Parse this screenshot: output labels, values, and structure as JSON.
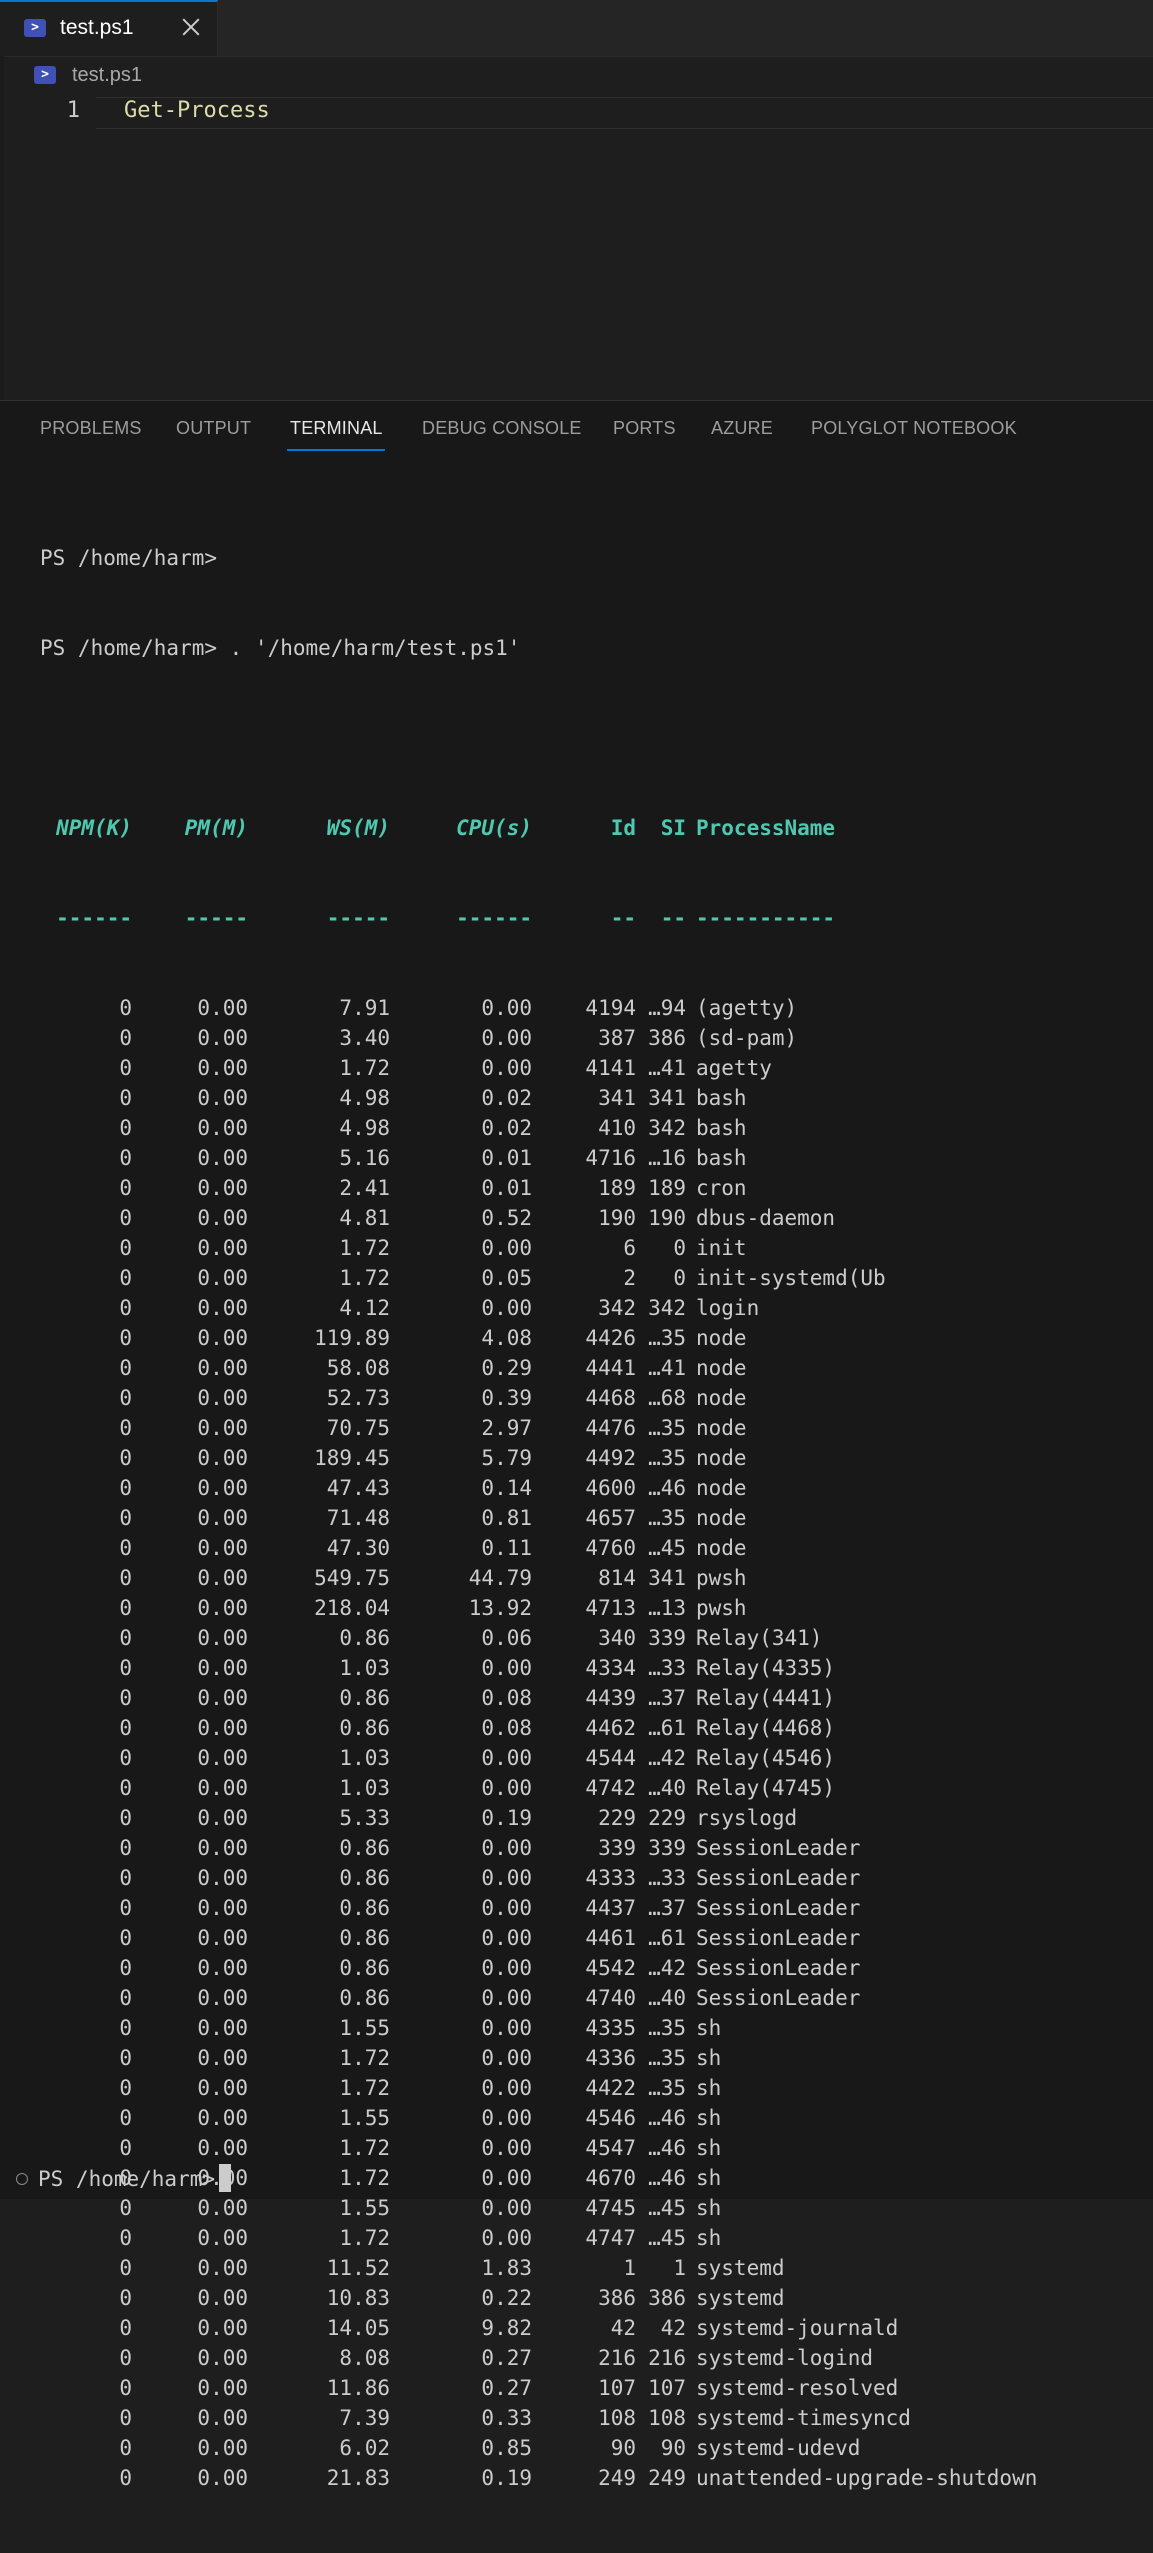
{
  "tab": {
    "title": "test.ps1",
    "icon": "powershell-icon"
  },
  "breadcrumb": {
    "file": "test.ps1",
    "icon": "powershell-icon"
  },
  "editor": {
    "line_number": "1",
    "code": "Get-Process"
  },
  "panel": {
    "tabs": [
      {
        "label": "PROBLEMS",
        "active": false
      },
      {
        "label": "OUTPUT",
        "active": false
      },
      {
        "label": "TERMINAL",
        "active": true
      },
      {
        "label": "DEBUG CONSOLE",
        "active": false
      },
      {
        "label": "PORTS",
        "active": false
      },
      {
        "label": "AZURE",
        "active": false
      },
      {
        "label": "POLYGLOT NOTEBOOK",
        "active": false
      }
    ]
  },
  "terminal": {
    "prompt1": "PS /home/harm>",
    "prompt2": "PS /home/harm> . '/home/harm/test.ps1'",
    "final_prompt": "PS /home/harm>",
    "headers": {
      "npm": "NPM(K)",
      "pm": "PM(M)",
      "ws": "WS(M)",
      "cpu": "CPU(s)",
      "id": "Id",
      "si": "SI",
      "name": "ProcessName"
    },
    "separators": {
      "npm": "------",
      "pm": "-----",
      "ws": "-----",
      "cpu": "------",
      "id": "--",
      "si": "--",
      "name": "-----------"
    },
    "rows": [
      {
        "npm": "0",
        "pm": "0.00",
        "ws": "7.91",
        "cpu": "0.00",
        "id": "4194",
        "si": "…94",
        "name": "(agetty)"
      },
      {
        "npm": "0",
        "pm": "0.00",
        "ws": "3.40",
        "cpu": "0.00",
        "id": "387",
        "si": "386",
        "name": "(sd-pam)"
      },
      {
        "npm": "0",
        "pm": "0.00",
        "ws": "1.72",
        "cpu": "0.00",
        "id": "4141",
        "si": "…41",
        "name": "agetty"
      },
      {
        "npm": "0",
        "pm": "0.00",
        "ws": "4.98",
        "cpu": "0.02",
        "id": "341",
        "si": "341",
        "name": "bash"
      },
      {
        "npm": "0",
        "pm": "0.00",
        "ws": "4.98",
        "cpu": "0.02",
        "id": "410",
        "si": "342",
        "name": "bash"
      },
      {
        "npm": "0",
        "pm": "0.00",
        "ws": "5.16",
        "cpu": "0.01",
        "id": "4716",
        "si": "…16",
        "name": "bash"
      },
      {
        "npm": "0",
        "pm": "0.00",
        "ws": "2.41",
        "cpu": "0.01",
        "id": "189",
        "si": "189",
        "name": "cron"
      },
      {
        "npm": "0",
        "pm": "0.00",
        "ws": "4.81",
        "cpu": "0.52",
        "id": "190",
        "si": "190",
        "name": "dbus-daemon"
      },
      {
        "npm": "0",
        "pm": "0.00",
        "ws": "1.72",
        "cpu": "0.00",
        "id": "6",
        "si": "0",
        "name": "init"
      },
      {
        "npm": "0",
        "pm": "0.00",
        "ws": "1.72",
        "cpu": "0.05",
        "id": "2",
        "si": "0",
        "name": "init-systemd(Ub"
      },
      {
        "npm": "0",
        "pm": "0.00",
        "ws": "4.12",
        "cpu": "0.00",
        "id": "342",
        "si": "342",
        "name": "login"
      },
      {
        "npm": "0",
        "pm": "0.00",
        "ws": "119.89",
        "cpu": "4.08",
        "id": "4426",
        "si": "…35",
        "name": "node"
      },
      {
        "npm": "0",
        "pm": "0.00",
        "ws": "58.08",
        "cpu": "0.29",
        "id": "4441",
        "si": "…41",
        "name": "node"
      },
      {
        "npm": "0",
        "pm": "0.00",
        "ws": "52.73",
        "cpu": "0.39",
        "id": "4468",
        "si": "…68",
        "name": "node"
      },
      {
        "npm": "0",
        "pm": "0.00",
        "ws": "70.75",
        "cpu": "2.97",
        "id": "4476",
        "si": "…35",
        "name": "node"
      },
      {
        "npm": "0",
        "pm": "0.00",
        "ws": "189.45",
        "cpu": "5.79",
        "id": "4492",
        "si": "…35",
        "name": "node"
      },
      {
        "npm": "0",
        "pm": "0.00",
        "ws": "47.43",
        "cpu": "0.14",
        "id": "4600",
        "si": "…46",
        "name": "node"
      },
      {
        "npm": "0",
        "pm": "0.00",
        "ws": "71.48",
        "cpu": "0.81",
        "id": "4657",
        "si": "…35",
        "name": "node"
      },
      {
        "npm": "0",
        "pm": "0.00",
        "ws": "47.30",
        "cpu": "0.11",
        "id": "4760",
        "si": "…45",
        "name": "node"
      },
      {
        "npm": "0",
        "pm": "0.00",
        "ws": "549.75",
        "cpu": "44.79",
        "id": "814",
        "si": "341",
        "name": "pwsh"
      },
      {
        "npm": "0",
        "pm": "0.00",
        "ws": "218.04",
        "cpu": "13.92",
        "id": "4713",
        "si": "…13",
        "name": "pwsh"
      },
      {
        "npm": "0",
        "pm": "0.00",
        "ws": "0.86",
        "cpu": "0.06",
        "id": "340",
        "si": "339",
        "name": "Relay(341)"
      },
      {
        "npm": "0",
        "pm": "0.00",
        "ws": "1.03",
        "cpu": "0.00",
        "id": "4334",
        "si": "…33",
        "name": "Relay(4335)"
      },
      {
        "npm": "0",
        "pm": "0.00",
        "ws": "0.86",
        "cpu": "0.08",
        "id": "4439",
        "si": "…37",
        "name": "Relay(4441)"
      },
      {
        "npm": "0",
        "pm": "0.00",
        "ws": "0.86",
        "cpu": "0.08",
        "id": "4462",
        "si": "…61",
        "name": "Relay(4468)"
      },
      {
        "npm": "0",
        "pm": "0.00",
        "ws": "1.03",
        "cpu": "0.00",
        "id": "4544",
        "si": "…42",
        "name": "Relay(4546)"
      },
      {
        "npm": "0",
        "pm": "0.00",
        "ws": "1.03",
        "cpu": "0.00",
        "id": "4742",
        "si": "…40",
        "name": "Relay(4745)"
      },
      {
        "npm": "0",
        "pm": "0.00",
        "ws": "5.33",
        "cpu": "0.19",
        "id": "229",
        "si": "229",
        "name": "rsyslogd"
      },
      {
        "npm": "0",
        "pm": "0.00",
        "ws": "0.86",
        "cpu": "0.00",
        "id": "339",
        "si": "339",
        "name": "SessionLeader"
      },
      {
        "npm": "0",
        "pm": "0.00",
        "ws": "0.86",
        "cpu": "0.00",
        "id": "4333",
        "si": "…33",
        "name": "SessionLeader"
      },
      {
        "npm": "0",
        "pm": "0.00",
        "ws": "0.86",
        "cpu": "0.00",
        "id": "4437",
        "si": "…37",
        "name": "SessionLeader"
      },
      {
        "npm": "0",
        "pm": "0.00",
        "ws": "0.86",
        "cpu": "0.00",
        "id": "4461",
        "si": "…61",
        "name": "SessionLeader"
      },
      {
        "npm": "0",
        "pm": "0.00",
        "ws": "0.86",
        "cpu": "0.00",
        "id": "4542",
        "si": "…42",
        "name": "SessionLeader"
      },
      {
        "npm": "0",
        "pm": "0.00",
        "ws": "0.86",
        "cpu": "0.00",
        "id": "4740",
        "si": "…40",
        "name": "SessionLeader"
      },
      {
        "npm": "0",
        "pm": "0.00",
        "ws": "1.55",
        "cpu": "0.00",
        "id": "4335",
        "si": "…35",
        "name": "sh"
      },
      {
        "npm": "0",
        "pm": "0.00",
        "ws": "1.72",
        "cpu": "0.00",
        "id": "4336",
        "si": "…35",
        "name": "sh"
      },
      {
        "npm": "0",
        "pm": "0.00",
        "ws": "1.72",
        "cpu": "0.00",
        "id": "4422",
        "si": "…35",
        "name": "sh"
      },
      {
        "npm": "0",
        "pm": "0.00",
        "ws": "1.55",
        "cpu": "0.00",
        "id": "4546",
        "si": "…46",
        "name": "sh"
      },
      {
        "npm": "0",
        "pm": "0.00",
        "ws": "1.72",
        "cpu": "0.00",
        "id": "4547",
        "si": "…46",
        "name": "sh"
      },
      {
        "npm": "0",
        "pm": "0.00",
        "ws": "1.72",
        "cpu": "0.00",
        "id": "4670",
        "si": "…46",
        "name": "sh"
      },
      {
        "npm": "0",
        "pm": "0.00",
        "ws": "1.55",
        "cpu": "0.00",
        "id": "4745",
        "si": "…45",
        "name": "sh"
      },
      {
        "npm": "0",
        "pm": "0.00",
        "ws": "1.72",
        "cpu": "0.00",
        "id": "4747",
        "si": "…45",
        "name": "sh"
      },
      {
        "npm": "0",
        "pm": "0.00",
        "ws": "11.52",
        "cpu": "1.83",
        "id": "1",
        "si": "1",
        "name": "systemd"
      },
      {
        "npm": "0",
        "pm": "0.00",
        "ws": "10.83",
        "cpu": "0.22",
        "id": "386",
        "si": "386",
        "name": "systemd"
      },
      {
        "npm": "0",
        "pm": "0.00",
        "ws": "14.05",
        "cpu": "9.82",
        "id": "42",
        "si": "42",
        "name": "systemd-journald"
      },
      {
        "npm": "0",
        "pm": "0.00",
        "ws": "8.08",
        "cpu": "0.27",
        "id": "216",
        "si": "216",
        "name": "systemd-logind"
      },
      {
        "npm": "0",
        "pm": "0.00",
        "ws": "11.86",
        "cpu": "0.27",
        "id": "107",
        "si": "107",
        "name": "systemd-resolved"
      },
      {
        "npm": "0",
        "pm": "0.00",
        "ws": "7.39",
        "cpu": "0.33",
        "id": "108",
        "si": "108",
        "name": "systemd-timesyncd"
      },
      {
        "npm": "0",
        "pm": "0.00",
        "ws": "6.02",
        "cpu": "0.85",
        "id": "90",
        "si": "90",
        "name": "systemd-udevd"
      },
      {
        "npm": "0",
        "pm": "0.00",
        "ws": "21.83",
        "cpu": "0.19",
        "id": "249",
        "si": "249",
        "name": "unattended-upgrade-shutdown"
      }
    ]
  },
  "colors": {
    "accent": "#0078d4",
    "header": "#4ec9b0",
    "code": "#dcdcaa"
  }
}
